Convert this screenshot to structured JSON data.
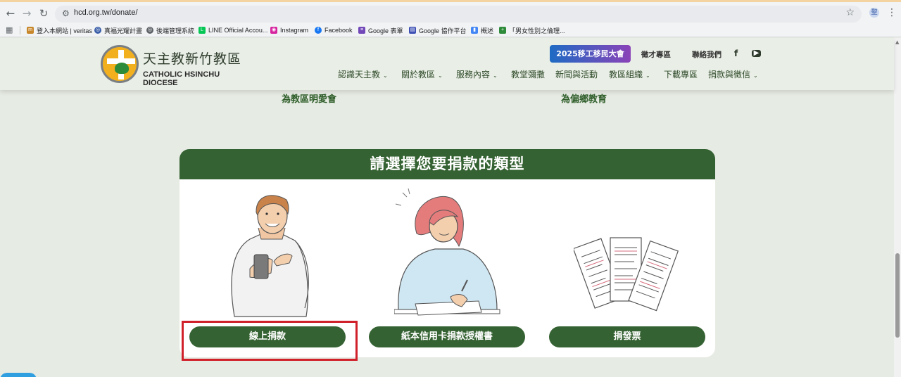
{
  "browser": {
    "url": "hcd.org.tw/donate/",
    "profile_initial": "聖",
    "bookmarks": [
      {
        "label": "登入本網站 | veritas",
        "color": "#c8862a",
        "icon": "veritas-icon"
      },
      {
        "label": "真福光耀計畫",
        "color": "#3b5ea8",
        "icon": "globe-icon"
      },
      {
        "label": "後端管理系統",
        "color": "#5f6368",
        "icon": "globe-icon"
      },
      {
        "label": "LINE Official Accou...",
        "color": "#06c755",
        "icon": "line-icon"
      },
      {
        "label": "Instagram",
        "color": "#d6249f",
        "icon": "instagram-icon"
      },
      {
        "label": "Facebook",
        "color": "#1877f2",
        "icon": "facebook-icon"
      },
      {
        "label": "Google 表單",
        "color": "#7248b9",
        "icon": "google-forms-icon"
      },
      {
        "label": "Google 協作平台",
        "color": "#3f51b5",
        "icon": "google-sites-icon"
      },
      {
        "label": "概述",
        "color": "#4285f4",
        "icon": "analytics-icon"
      },
      {
        "label": "「男女性別之倫理...",
        "color": "#2e8b3a",
        "icon": "doc-icon"
      }
    ]
  },
  "header": {
    "logo_cn": "天主教新竹教區",
    "logo_en": "CATHOLIC HSINCHU DIOCESE",
    "cta": "2025移工移民大會",
    "top_links": [
      "徵才專區",
      "聯絡我們"
    ],
    "social": [
      "f",
      "▶"
    ],
    "menu": [
      {
        "label": "認識天主教",
        "dropdown": true
      },
      {
        "label": "關於教區",
        "dropdown": true
      },
      {
        "label": "服務內容",
        "dropdown": true
      },
      {
        "label": "教堂彌撒",
        "dropdown": false
      },
      {
        "label": "新聞與活動",
        "dropdown": false
      },
      {
        "label": "教區組織",
        "dropdown": true
      },
      {
        "label": "下載專區",
        "dropdown": false
      },
      {
        "label": "捐款與徵信",
        "dropdown": true
      }
    ]
  },
  "content": {
    "sub_headings": [
      "為教區明愛會",
      "為偏鄉教育"
    ],
    "card_title": "請選擇您要捐款的類型",
    "options": [
      {
        "label": "線上捐款",
        "illustration": "person-with-phone"
      },
      {
        "label": "紙本信用卡捐款授權書",
        "illustration": "person-writing"
      },
      {
        "label": "捐發票",
        "illustration": "receipts"
      }
    ]
  },
  "colors": {
    "brand_green": "#356232",
    "page_bg": "#e6ebe3",
    "highlight": "#d0202a"
  }
}
